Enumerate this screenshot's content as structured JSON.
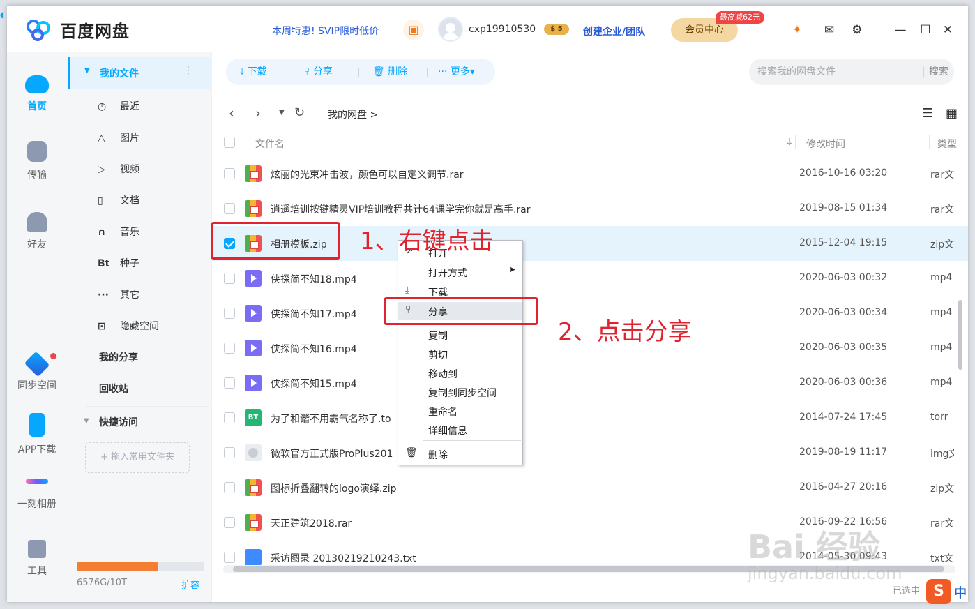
{
  "app": {
    "brand": "百度网盘",
    "promo": "本周特惠! SVIP限时低价",
    "username": "cxp19910530",
    "svip_badge": "$ 5",
    "create_team": "创建企业/团队",
    "vip_center": "会员中心",
    "vip_promo": "最高减62元",
    "colors": {
      "accent": "#06a7ff",
      "annotation": "#e0242f",
      "selected_row": "#e5f3fd"
    }
  },
  "rail": [
    {
      "label": "首页",
      "icon": "cloud-icon"
    },
    {
      "label": "传输",
      "icon": "transfer-icon"
    },
    {
      "label": "好友",
      "icon": "friends-icon"
    },
    {
      "label": "同步空间",
      "icon": "sync-icon"
    },
    {
      "label": "APP下载",
      "icon": "phone-icon"
    },
    {
      "label": "一刻相册",
      "icon": "album-icon"
    },
    {
      "label": "工具",
      "icon": "tools-icon"
    }
  ],
  "sidebar": {
    "my_files": "我的文件",
    "items": [
      {
        "icon": "◷",
        "label": "最近"
      },
      {
        "icon": "△",
        "label": "图片"
      },
      {
        "icon": "▷",
        "label": "视频"
      },
      {
        "icon": "▯",
        "label": "文档"
      },
      {
        "icon": "∩",
        "label": "音乐"
      },
      {
        "icon": "Bt",
        "label": "种子"
      },
      {
        "icon": "···",
        "label": "其它"
      },
      {
        "icon": "⊡",
        "label": "隐藏空间"
      }
    ],
    "my_share": "我的分享",
    "recycle": "回收站",
    "quick_access": "快捷访问",
    "drop_zone": "+ 拖入常用文件夹",
    "quota": "6576G/10T",
    "quota_fraction": 0.64,
    "expand": "扩容"
  },
  "toolbar": {
    "download": "下载",
    "share": "分享",
    "delete": "删除",
    "more": "更多▾"
  },
  "search": {
    "placeholder": "搜索我的网盘文件",
    "button": "搜索"
  },
  "breadcrumb": "我的网盘 >",
  "table": {
    "headers": {
      "name": "文件名",
      "mtime": "修改时间",
      "type": "类型"
    },
    "rows": [
      {
        "icon": "zip",
        "name": "炫丽的光束冲击波，颜色可以自定义调节.rar",
        "time": "2016-10-16 03:20",
        "type": "rar文件"
      },
      {
        "icon": "zip",
        "name": "逍遥培训按键精灵VIP培训教程共计64课学完你就是高手.rar",
        "time": "2019-08-15 01:34",
        "type": "rar文件"
      },
      {
        "icon": "zip",
        "name": "相册模板.zip",
        "time": "2015-12-04 19:15",
        "type": "zip文件",
        "selected": true
      },
      {
        "icon": "video",
        "name": "侠探简不知18.mp4",
        "time": "2020-06-03 00:32",
        "type": "mp4"
      },
      {
        "icon": "video",
        "name": "侠探简不知17.mp4",
        "time": "2020-06-03 00:34",
        "type": "mp4"
      },
      {
        "icon": "video",
        "name": "侠探简不知16.mp4",
        "time": "2020-06-03 00:35",
        "type": "mp4"
      },
      {
        "icon": "video",
        "name": "侠探简不知15.mp4",
        "time": "2020-06-03 00:36",
        "type": "mp4"
      },
      {
        "icon": "bt",
        "name": "为了和谐不用霸气名称了.to",
        "time": "2014-07-24 17:45",
        "type": "torr"
      },
      {
        "icon": "img",
        "name": "微软官方正式版ProPlus201",
        "time": "2019-08-19 11:17",
        "type": "img文"
      },
      {
        "icon": "zip",
        "name": "图标折叠翻转的logo演绎.zip",
        "time": "2016-04-27 20:16",
        "type": "zip文"
      },
      {
        "icon": "zip",
        "name": "天正建筑2018.rar",
        "time": "2016-09-22 16:56",
        "type": "rar文"
      },
      {
        "icon": "txt",
        "name": "采访图录 20130219210243.txt",
        "time": "2014-05-30 09:43",
        "type": "txt文"
      }
    ]
  },
  "context_menu": {
    "items": [
      {
        "icon": "↗",
        "label": "打开"
      },
      {
        "icon": "",
        "label": "打开方式",
        "submenu": true
      },
      {
        "icon": "⤓",
        "label": "下载"
      },
      {
        "icon": "⑂",
        "label": "分享",
        "highlight": true
      },
      {
        "icon": "",
        "label": "复制"
      },
      {
        "icon": "",
        "label": "剪切"
      },
      {
        "icon": "",
        "label": "移动到"
      },
      {
        "icon": "",
        "label": "复制到同步空间"
      },
      {
        "icon": "",
        "label": "重命名"
      },
      {
        "icon": "",
        "label": "详细信息"
      },
      {
        "icon": "🗑",
        "label": "删除"
      }
    ]
  },
  "annotations": {
    "step1": "1、右键点击",
    "step2": "2、点击分享"
  },
  "status": {
    "selected": "已选中"
  },
  "watermark": {
    "text": "Bai 经验",
    "url": "jingyan.baidu.com"
  },
  "ime": {
    "logo": "S",
    "mode": "中"
  }
}
